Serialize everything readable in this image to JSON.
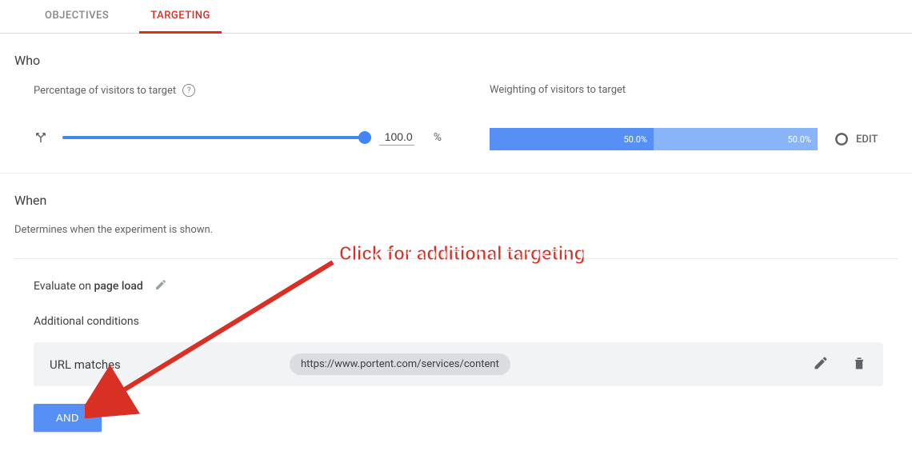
{
  "tabs": {
    "objectives": "OBJECTIVES",
    "targeting": "TARGETING"
  },
  "who": {
    "title": "Who",
    "pct_label": "Percentage of visitors to target",
    "pct_value": "100.0",
    "pct_suffix": "%",
    "weight_label": "Weighting of visitors to target",
    "weights": {
      "a": "50.0%",
      "b": "50.0%"
    },
    "edit": "EDIT"
  },
  "when": {
    "title": "When",
    "subtitle": "Determines when the experiment is shown.",
    "eval_prefix": "Evaluate on ",
    "eval_bold": "page load",
    "additional": "Additional conditions",
    "condition": {
      "label": "URL matches",
      "chip": "https://www.portent.com/services/content"
    },
    "and": "AND"
  },
  "annotation": {
    "text": "Click for additional targeting"
  }
}
